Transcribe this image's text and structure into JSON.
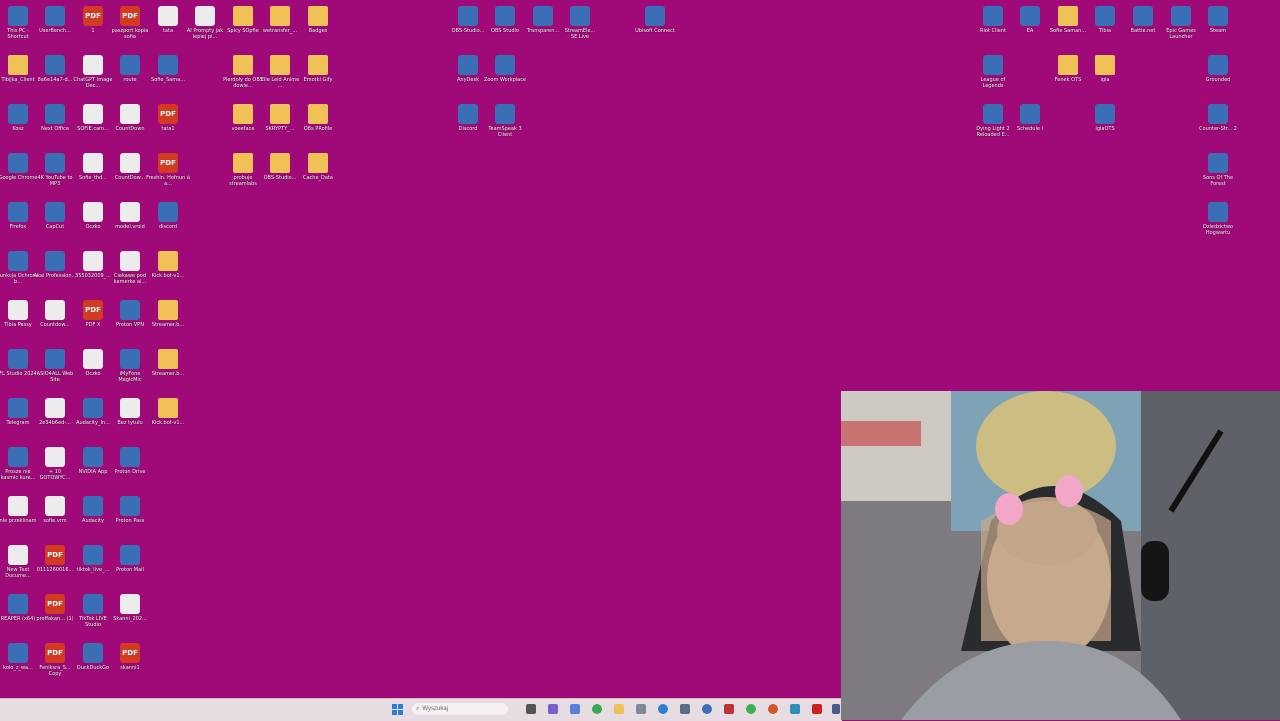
{
  "desktop": {
    "icons": [
      {
        "label": "This PC - Shortcut",
        "kind": "app"
      },
      {
        "label": "UserBench...",
        "kind": "app"
      },
      {
        "label": "1",
        "kind": "pdf"
      },
      {
        "label": "paszport kopia sofia",
        "kind": "pdf"
      },
      {
        "label": "tata",
        "kind": "doc"
      },
      {
        "label": "AI Prompty jak lepiej pi...",
        "kind": "doc"
      },
      {
        "label": "Spicy SOpfie",
        "kind": "folder"
      },
      {
        "label": "wetransfer_...",
        "kind": "folder"
      },
      {
        "label": "Badges",
        "kind": "folder"
      },
      {
        "label": "Tibijka_Client",
        "kind": "folder"
      },
      {
        "label": "8a6e14a7-d...",
        "kind": "app"
      },
      {
        "label": "ChatGPT Image Dec...",
        "kind": "doc"
      },
      {
        "label": "route",
        "kind": "app"
      },
      {
        "label": "Sofie_Sama...",
        "kind": "app"
      },
      {
        "label": "Pierdoly do OBS dowie...",
        "kind": "folder"
      },
      {
        "label": "Elle Leid Anime ...",
        "kind": "folder"
      },
      {
        "label": "Emotki Gify",
        "kind": "folder"
      },
      {
        "label": "Kosz",
        "kind": "app"
      },
      {
        "label": "Next Office",
        "kind": "app"
      },
      {
        "label": "SOFIE.cam...",
        "kind": "doc"
      },
      {
        "label": "CountDown",
        "kind": "doc"
      },
      {
        "label": "tata1",
        "kind": "pdf"
      },
      {
        "label": "voeeface",
        "kind": "folder"
      },
      {
        "label": "SKRYPTY_...",
        "kind": "folder"
      },
      {
        "label": "OBs PRofile",
        "kind": "folder"
      },
      {
        "label": "Google Chrome",
        "kind": "app"
      },
      {
        "label": "4K YouTube to MP3",
        "kind": "app"
      },
      {
        "label": "Sofie_thd...",
        "kind": "doc"
      },
      {
        "label": "CountDow...",
        "kind": "doc"
      },
      {
        "label": "Freshin. Hofnun á a...",
        "kind": "pdf"
      },
      {
        "label": "probuje streamlabs",
        "kind": "folder"
      },
      {
        "label": "OBS-Studio...",
        "kind": "folder"
      },
      {
        "label": "Cache_Data",
        "kind": "folder"
      },
      {
        "label": "Firefox",
        "kind": "app"
      },
      {
        "label": "CapCut",
        "kind": "app"
      },
      {
        "label": "Oczko",
        "kind": "doc"
      },
      {
        "label": "model.vroid",
        "kind": "doc"
      },
      {
        "label": "discord",
        "kind": "app"
      },
      {
        "label": "Funkcja Ochrona b...",
        "kind": "app"
      },
      {
        "label": "Akai Profession...",
        "kind": "app"
      },
      {
        "label": "355032009_...",
        "kind": "doc"
      },
      {
        "label": "Ciekawe pod kamerke al...",
        "kind": "doc"
      },
      {
        "label": "Kick.bot-v1...",
        "kind": "folder"
      },
      {
        "label": "Tibia Passy",
        "kind": "doc"
      },
      {
        "label": "Countdow...",
        "kind": "doc"
      },
      {
        "label": "PDF X",
        "kind": "pdf"
      },
      {
        "label": "Proton VPN",
        "kind": "app"
      },
      {
        "label": "Streamer.b...",
        "kind": "folder"
      },
      {
        "label": "FL Studio 2024",
        "kind": "app"
      },
      {
        "label": "ASIO4ALL Web Site",
        "kind": "app"
      },
      {
        "label": "Oczko",
        "kind": "doc"
      },
      {
        "label": "iMyFone MagicMic",
        "kind": "app"
      },
      {
        "label": "Streamer.b...",
        "kind": "folder"
      },
      {
        "label": "Telegram",
        "kind": "app"
      },
      {
        "label": "2e34b6ed-...",
        "kind": "doc"
      },
      {
        "label": "Audacity_In...",
        "kind": "app"
      },
      {
        "label": "Bez tytułu",
        "kind": "doc"
      },
      {
        "label": "Kick.bot-v1...",
        "kind": "folder"
      },
      {
        "label": "Prosze nie kasmic kure...",
        "kind": "app"
      },
      {
        "label": "+ 10 GOTOWYC...",
        "kind": "doc"
      },
      {
        "label": "NVIDIA App",
        "kind": "app"
      },
      {
        "label": "Proton Drive",
        "kind": "app"
      },
      {
        "label": "nie przeklinam",
        "kind": "doc"
      },
      {
        "label": "sofie.vrm",
        "kind": "doc"
      },
      {
        "label": "Audacity",
        "kind": "app"
      },
      {
        "label": "Proton Pass",
        "kind": "app"
      },
      {
        "label": "New Text Docume...",
        "kind": "doc"
      },
      {
        "label": "0111260016...",
        "kind": "pdf"
      },
      {
        "label": "tiktok_live_...",
        "kind": "app"
      },
      {
        "label": "Proton Mail",
        "kind": "app"
      },
      {
        "label": "REAPER (x64)",
        "kind": "app"
      },
      {
        "label": "proffakan... (1)",
        "kind": "pdf"
      },
      {
        "label": "TikTok LIVE Studio",
        "kind": "app"
      },
      {
        "label": "Skanni_202...",
        "kind": "doc"
      },
      {
        "label": "kolo_z_wa...",
        "kind": "app"
      },
      {
        "label": "Feniksra_S... Copy",
        "kind": "pdf"
      },
      {
        "label": "DuckDuckGo",
        "kind": "app"
      },
      {
        "label": "skanni1",
        "kind": "pdf"
      },
      {
        "label": "OBS-Studio...",
        "kind": "app"
      },
      {
        "label": "OBS Studio",
        "kind": "app"
      },
      {
        "label": "Transparen...",
        "kind": "app"
      },
      {
        "label": "StreamEle... SE.Live",
        "kind": "app"
      },
      {
        "label": "Ubisoft Connect",
        "kind": "app"
      },
      {
        "label": "AnyDesk",
        "kind": "app"
      },
      {
        "label": "Zoom Workplace",
        "kind": "app"
      },
      {
        "label": "Discord",
        "kind": "app"
      },
      {
        "label": "TeamSpeak 3 Client",
        "kind": "app"
      },
      {
        "label": "Riot Client",
        "kind": "app"
      },
      {
        "label": "EA",
        "kind": "app"
      },
      {
        "label": "Sofie Saman...",
        "kind": "folder"
      },
      {
        "label": "Tibia",
        "kind": "app"
      },
      {
        "label": "Battle.net",
        "kind": "app"
      },
      {
        "label": "Epic Games Launcher",
        "kind": "app"
      },
      {
        "label": "Steam",
        "kind": "app"
      },
      {
        "label": "League of Legends",
        "kind": "app"
      },
      {
        "label": "Fenek OTS",
        "kind": "folder"
      },
      {
        "label": "igla",
        "kind": "folder"
      },
      {
        "label": "Grounded",
        "kind": "app"
      },
      {
        "label": "Dying Light 2 Reloaded E...",
        "kind": "app"
      },
      {
        "label": "Schedule I",
        "kind": "app"
      },
      {
        "label": "IglaOTS",
        "kind": "app"
      },
      {
        "label": "Counter-Str... 2",
        "kind": "app"
      },
      {
        "label": "Sons Of The Forest",
        "kind": "app"
      },
      {
        "label": "Dziedzictwo Hogwartu",
        "kind": "app"
      }
    ]
  },
  "taskbar": {
    "search_placeholder": "Wyszukaj"
  },
  "colors": {
    "desktop": "#9f0a78",
    "folder": "#f0c156",
    "pdf": "#d33a22"
  }
}
